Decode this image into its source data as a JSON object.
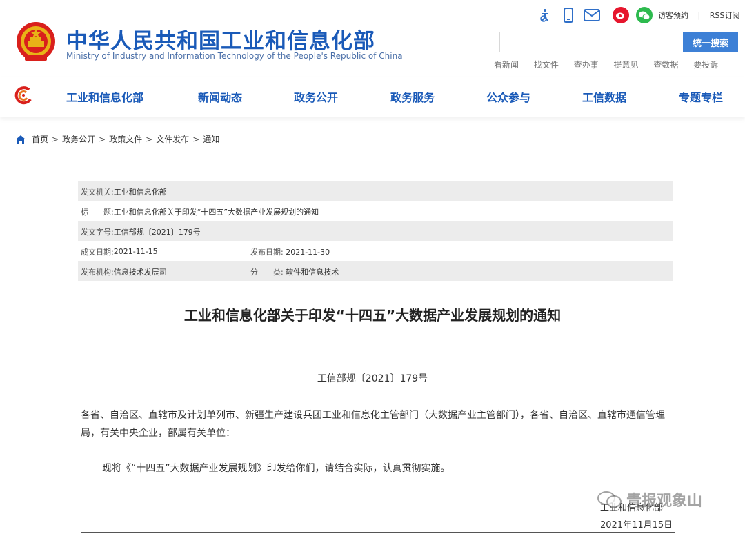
{
  "header": {
    "title_cn": "中华人民共和国工业和信息化部",
    "title_en": "Ministry of Industry and Information Technology of the People's Republic of China",
    "top_links": {
      "visitor": "访客预约",
      "rss": "RSS订阅",
      "sep": "|"
    },
    "search": {
      "placeholder": "",
      "button": "统一搜索"
    },
    "quick_links": [
      "看新闻",
      "找文件",
      "查办事",
      "提意见",
      "查数据",
      "要投诉"
    ],
    "icons": [
      "accessibility-icon",
      "mobile-icon",
      "mail-icon",
      "weibo-icon",
      "wechat-icon"
    ]
  },
  "nav": {
    "items": [
      "工业和信息化部",
      "新闻动态",
      "政务公开",
      "政务服务",
      "公众参与",
      "工信数据",
      "专题专栏"
    ]
  },
  "breadcrumb": {
    "items": [
      "首页",
      "政务公开",
      "政策文件",
      "文件发布",
      "通知"
    ],
    "separator": ">"
  },
  "meta": {
    "issuer_label": "发文机关:",
    "issuer": "工业和信息化部",
    "title_label": "标　　题:",
    "title": "工业和信息化部关于印发“十四五”大数据产业发展规划的通知",
    "doc_no_label": "发文字号:",
    "doc_no": "工信部规〔2021〕179号",
    "created_label": "成文日期:",
    "created": "2021-11-15",
    "published_label": "发布日期:",
    "published": "2021-11-30",
    "org_label": "发布机构:",
    "org": "信息技术发展司",
    "category_label": "分　　类:",
    "category": "软件和信息技术"
  },
  "document": {
    "title": "工业和信息化部关于印发“十四五”大数据产业发展规划的通知",
    "number": "工信部规〔2021〕179号",
    "recipients": "各省、自治区、直辖市及计划单列市、新疆生产建设兵团工业和信息化主管部门（大数据产业主管部门），各省、自治区、直辖市通信管理局，有关中央企业，部属有关单位：",
    "body": "现将《“十四五”大数据产业发展规划》印发给你们，请结合实际，认真贯彻实施。",
    "signature": "工业和信息化部",
    "date": "2021年11月15日"
  },
  "watermark": "青报观象山",
  "colors": {
    "brand_blue": "#1a5ab8",
    "search_btn": "#3d80d6",
    "row_shade": "#ececec"
  }
}
